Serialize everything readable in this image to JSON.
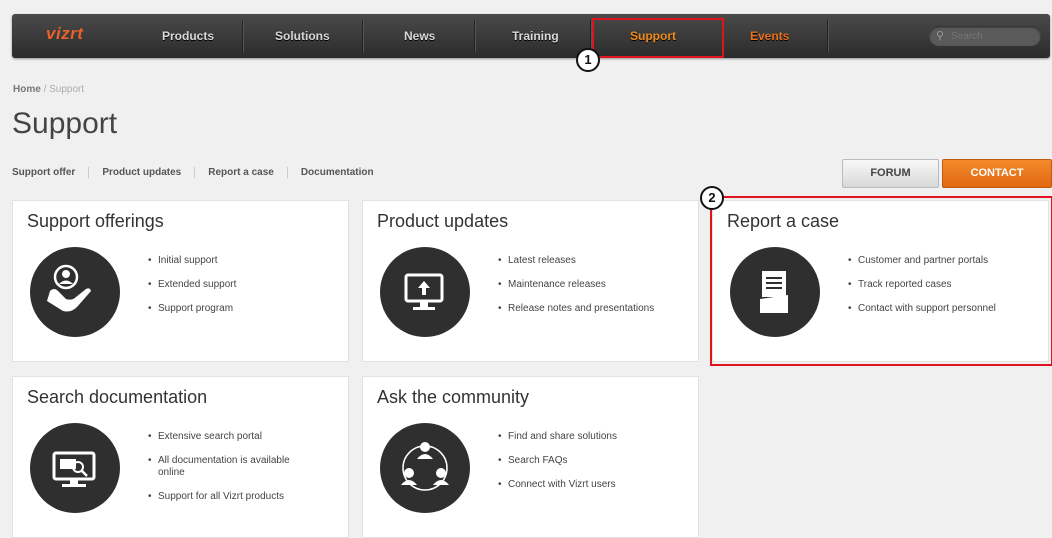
{
  "nav": {
    "logo": "vizrt",
    "items": [
      "Products",
      "Solutions",
      "News",
      "Training",
      "Support",
      "Events"
    ],
    "search_placeholder": "Search"
  },
  "annotations": [
    "1",
    "2"
  ],
  "breadcrumb": {
    "home": "Home",
    "separator": "/",
    "current": "Support"
  },
  "page_title": "Support",
  "subnav": [
    "Support offer",
    "Product updates",
    "Report a case",
    "Documentation"
  ],
  "buttons": {
    "forum": "FORUM",
    "contact": "CONTACT"
  },
  "cards": [
    {
      "title": "Support offerings",
      "icon": "hand-user-icon",
      "items": [
        "Initial support",
        "Extended support",
        "Support program"
      ]
    },
    {
      "title": "Product updates",
      "icon": "monitor-upload-icon",
      "items": [
        "Latest releases",
        "Maintenance releases",
        "Release notes and presentations"
      ]
    },
    {
      "title": "Report a case",
      "icon": "document-folder-icon",
      "items": [
        "Customer and partner portals",
        "Track reported cases",
        "Contact with support personnel"
      ]
    },
    {
      "title": "Search documentation",
      "icon": "monitor-search-icon",
      "items": [
        "Extensive search portal",
        "All documentation is available online",
        "Support for all Vizrt products"
      ]
    },
    {
      "title": "Ask the community",
      "icon": "people-network-icon",
      "items": [
        "Find and share solutions",
        "Search FAQs",
        "Connect with Vizrt users"
      ]
    }
  ],
  "colors": {
    "accent": "#f08a1c",
    "nav_bg": "#2b2b2b",
    "annotation": "#e0141c",
    "circle": "#2f2f2f"
  }
}
